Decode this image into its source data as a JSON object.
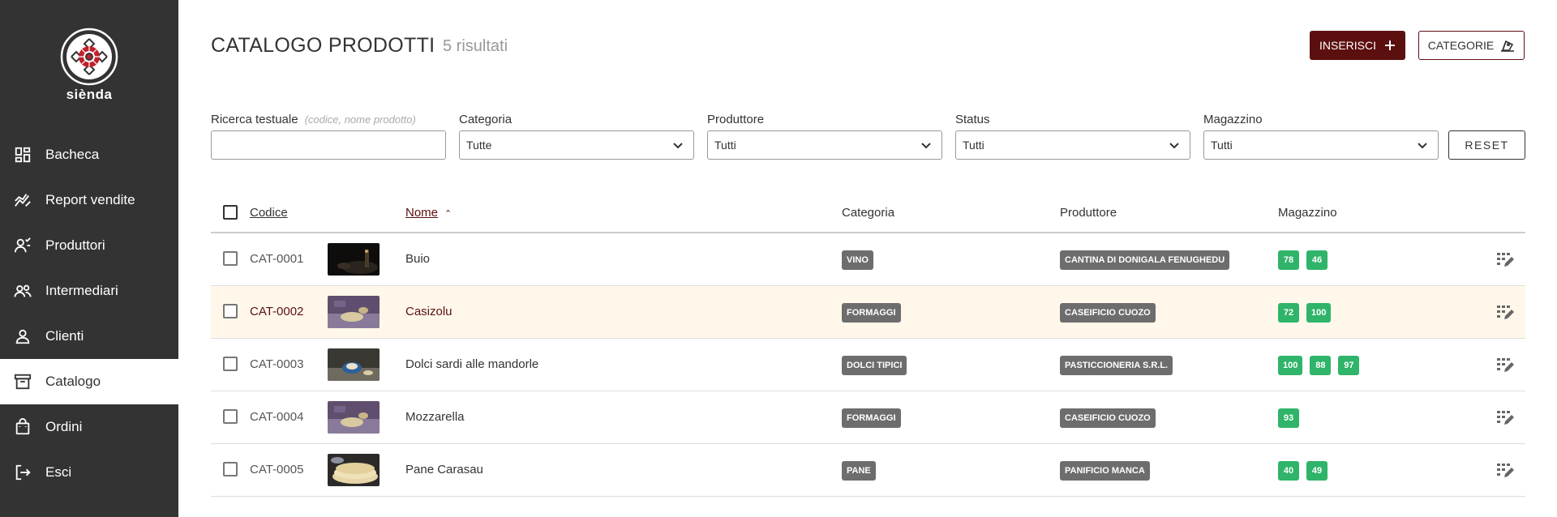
{
  "brand": {
    "name": "siènda"
  },
  "sidebar": {
    "items": [
      {
        "label": "Bacheca",
        "icon": "dashboard-icon"
      },
      {
        "label": "Report vendite",
        "icon": "chart-icon"
      },
      {
        "label": "Produttori",
        "icon": "producer-icon"
      },
      {
        "label": "Intermediari",
        "icon": "users-icon"
      },
      {
        "label": "Clienti",
        "icon": "user-icon"
      },
      {
        "label": "Catalogo",
        "icon": "archive-icon",
        "active": true
      },
      {
        "label": "Ordini",
        "icon": "bag-icon"
      },
      {
        "label": "Esci",
        "icon": "logout-icon"
      }
    ]
  },
  "header": {
    "title": "CATALOGO PRODOTTI",
    "results": "5 risultati",
    "insert_label": "INSERISCI",
    "categories_label": "CATEGORIE"
  },
  "filters": {
    "search_label": "Ricerca testuale",
    "search_hint": "(codice, nome prodotto)",
    "search_value": "",
    "category_label": "Categoria",
    "category_value": "Tutte",
    "producer_label": "Produttore",
    "producer_value": "Tutti",
    "status_label": "Status",
    "status_value": "Tutti",
    "warehouse_label": "Magazzino",
    "warehouse_value": "Tutti",
    "reset_label": "RESET"
  },
  "table": {
    "columns": {
      "code": "Codice",
      "name": "Nome",
      "category": "Categoria",
      "producer": "Produttore",
      "warehouse": "Magazzino"
    },
    "rows": [
      {
        "code": "CAT-0001",
        "name": "Buio",
        "category": "VINO",
        "producer": "CANTINA DI DONIGALA FENUGHEDU",
        "stock": [
          "78",
          "46"
        ]
      },
      {
        "code": "CAT-0002",
        "name": "Casizolu",
        "category": "FORMAGGI",
        "producer": "CASEIFICIO CUOZO",
        "stock": [
          "72",
          "100"
        ],
        "highlighted": true
      },
      {
        "code": "CAT-0003",
        "name": "Dolci sardi alle mandorle",
        "category": "DOLCI TIPICI",
        "producer": "PASTICCIONERIA S.R.L.",
        "stock": [
          "100",
          "88",
          "97"
        ]
      },
      {
        "code": "CAT-0004",
        "name": "Mozzarella",
        "category": "FORMAGGI",
        "producer": "CASEIFICIO CUOZO",
        "stock": [
          "93"
        ]
      },
      {
        "code": "CAT-0005",
        "name": "Pane Carasau",
        "category": "PANE",
        "producer": "PANIFICIO MANCA",
        "stock": [
          "40",
          "49"
        ]
      }
    ]
  },
  "colors": {
    "sidebar_bg": "#333333",
    "accent": "#5c0f0f",
    "stock_badge": "#2fb46a",
    "category_badge": "#6d6d6d",
    "highlight_row": "#fff8ea"
  }
}
